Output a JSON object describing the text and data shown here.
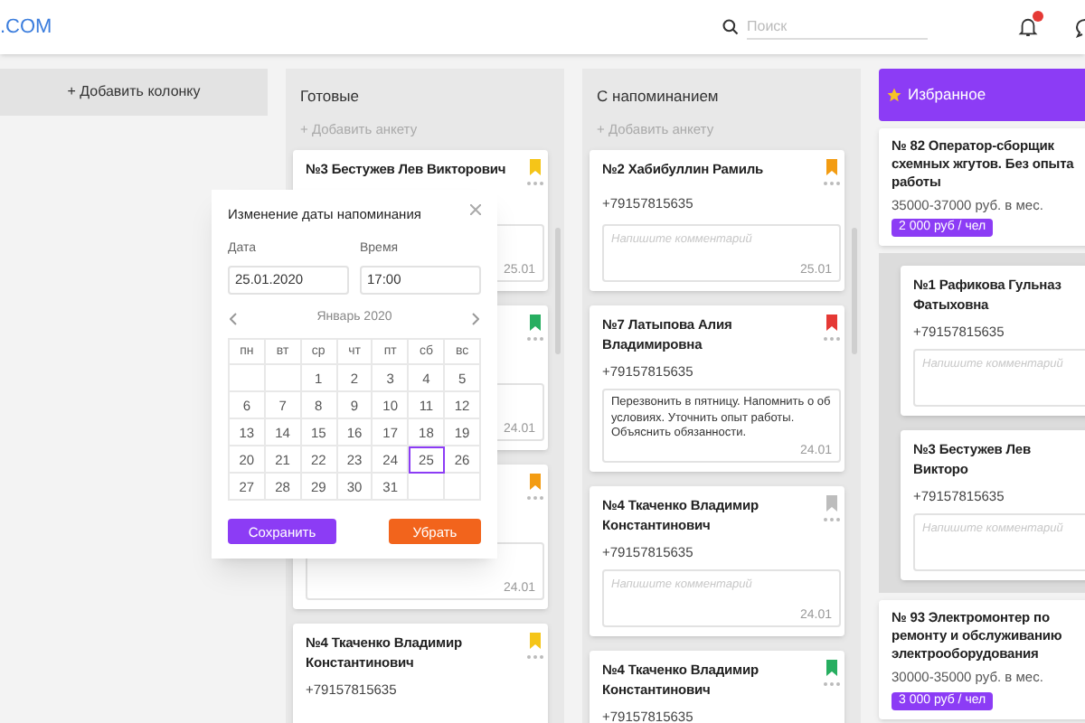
{
  "header": {
    "logo": ".COM",
    "search": {
      "placeholder": "Поиск"
    },
    "notifications": {
      "badge": true
    }
  },
  "add_column": "+ Добавить колонку",
  "columns": [
    {
      "title": "Готовые",
      "kind": "candidates",
      "add": "+ Добавить анкету",
      "cards": [
        {
          "name": "№3 Бестужев Лев Викторович",
          "date": "25.01",
          "color": "#f5c518"
        },
        {
          "date": "24.01",
          "color": "#27ae60"
        },
        {
          "date": "24.01",
          "color": "#f39c12"
        },
        {
          "name": "№4 Ткаченко Владимир Константинович",
          "phone": "+79157815635",
          "color": "#f5c518"
        }
      ]
    },
    {
      "title": "С напоминанием",
      "kind": "candidates",
      "add": "+ Добавить анкету",
      "cards": [
        {
          "name": "№2 Хабибуллин Рамиль",
          "phone": "+79157815635",
          "placeholder": "Напишите комментарий",
          "date": "25.01",
          "color": "#f39c12"
        },
        {
          "name": "№7 Латыпова Алия Владимировна",
          "phone": "+79157815635",
          "comment": "Перезвонить в пятницу. Напомнить о об условиях. Уточнить опыт работы. Объяснить обязанности.",
          "date": "24.01",
          "color": "#e53935"
        },
        {
          "name": "№4 Ткаченко Владимир Константинович",
          "phone": "+79157815635",
          "placeholder": "Напишите комментарий",
          "date": "24.01",
          "color": "#bdbdbd"
        },
        {
          "name": "№4 Ткаченко Владимир Константинович",
          "phone": "+79157815635",
          "color": "#27ae60"
        }
      ]
    },
    {
      "title": "Избранное",
      "kind": "favorites",
      "items": [
        {
          "kind": "vacancy",
          "title": "№ 82 Оператор-сборщик схемных жгутов. Без опыта работы",
          "salary": "35000-37000 руб. в мес.",
          "price": "2 000 руб / чел"
        },
        {
          "kind": "group",
          "cards": [
            {
              "name": "№1 Рафикова Гульназ Фатыховна",
              "phone": "+79157815635",
              "placeholder": "Напишите комментарий"
            },
            {
              "name": "№3 Бестужев Лев Викторо",
              "phone": "+79157815635",
              "placeholder": "Напишите комментарий"
            }
          ]
        },
        {
          "kind": "vacancy",
          "title": "№ 93 Электромонтер по ремонту и обслуживанию электрооборудования",
          "salary": "30000-35000 руб. в мес.",
          "price": "3 000 руб / чел"
        }
      ]
    }
  ],
  "dialog": {
    "title": "Изменение даты напоминания",
    "date_label": "Дата",
    "date_value": "25.01.2020",
    "time_label": "Время",
    "time_value": "17:00",
    "month": "Январь 2020",
    "weekdays": [
      "пн",
      "вт",
      "ср",
      "чт",
      "пт",
      "сб",
      "вс"
    ],
    "weeks": [
      [
        {
          "kind": "blank"
        },
        {
          "kind": "blank"
        },
        {
          "kind": "day",
          "day": "1",
          "selected": false
        },
        {
          "kind": "day",
          "day": "2",
          "selected": false
        },
        {
          "kind": "day",
          "day": "3",
          "selected": false
        },
        {
          "kind": "day",
          "day": "4",
          "selected": false
        },
        {
          "kind": "day",
          "day": "5",
          "selected": false
        }
      ],
      [
        {
          "kind": "day",
          "day": "6",
          "selected": false
        },
        {
          "kind": "day",
          "day": "7",
          "selected": false
        },
        {
          "kind": "day",
          "day": "8",
          "selected": false
        },
        {
          "kind": "day",
          "day": "9",
          "selected": false
        },
        {
          "kind": "day",
          "day": "10",
          "selected": false
        },
        {
          "kind": "day",
          "day": "11",
          "selected": false
        },
        {
          "kind": "day",
          "day": "12",
          "selected": false
        }
      ],
      [
        {
          "kind": "day",
          "day": "13",
          "selected": false
        },
        {
          "kind": "day",
          "day": "14",
          "selected": false
        },
        {
          "kind": "day",
          "day": "15",
          "selected": false
        },
        {
          "kind": "day",
          "day": "16",
          "selected": false
        },
        {
          "kind": "day",
          "day": "17",
          "selected": false
        },
        {
          "kind": "day",
          "day": "18",
          "selected": false
        },
        {
          "kind": "day",
          "day": "19",
          "selected": false
        }
      ],
      [
        {
          "kind": "day",
          "day": "20",
          "selected": false
        },
        {
          "kind": "day",
          "day": "21",
          "selected": false
        },
        {
          "kind": "day",
          "day": "22",
          "selected": false
        },
        {
          "kind": "day",
          "day": "23",
          "selected": false
        },
        {
          "kind": "day",
          "day": "24",
          "selected": false
        },
        {
          "kind": "day",
          "day": "25",
          "selected": true
        },
        {
          "kind": "day",
          "day": "26",
          "selected": false
        }
      ],
      [
        {
          "kind": "day",
          "day": "27",
          "selected": false
        },
        {
          "kind": "day",
          "day": "28",
          "selected": false
        },
        {
          "kind": "day",
          "day": "29",
          "selected": false
        },
        {
          "kind": "day",
          "day": "30",
          "selected": false
        },
        {
          "kind": "day",
          "day": "31",
          "selected": false
        },
        {
          "kind": "blank"
        },
        {
          "kind": "blank"
        }
      ]
    ],
    "save": "Сохранить",
    "remove": "Убрать"
  }
}
